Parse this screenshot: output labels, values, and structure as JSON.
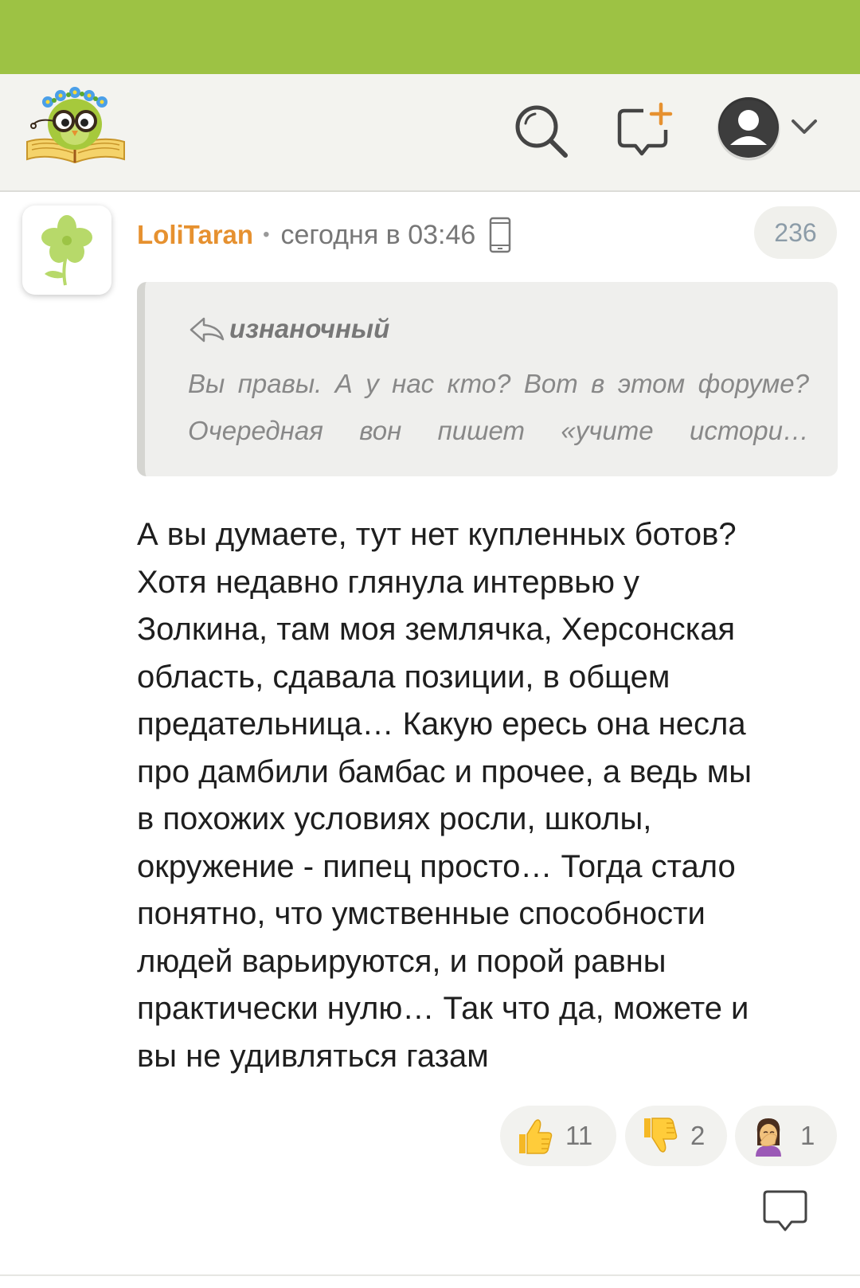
{
  "header": {
    "logo": "owl-reading-book-logo",
    "icons": [
      "search-icon",
      "new-post-icon",
      "user-icon",
      "chevron-down-icon"
    ]
  },
  "comment": {
    "username": "LoliTaran",
    "separator": "•",
    "timestamp": "сегодня в 03:46",
    "device_icon": "mobile-device-icon",
    "number": "236",
    "quote": {
      "author": "изнаночный",
      "text": "Вы правы. А у нас кто? Вот в этом форуме? Очередная вон пишет «учите истори…"
    },
    "body": "А вы думаете, тут нет купленных ботов?\nХотя недавно глянула интервью у\nЗолкина, там моя землячка, Херсонская\nобласть, сдавала позиции, в общем\nпредательница… Какую ересь она несла\nпро дамбили бамбас и прочее, а ведь мы\nв похожих условиях росли, школы,\nокружение - пипец просто… Тогда стало\nпонятно, что умственные способности\nлюдей варьируются, и порой равны\nпрактически нулю… Так что да, можете и\nвы не удивляться газам",
    "reactions": [
      {
        "icon": "thumbs-up-icon",
        "count": "11"
      },
      {
        "icon": "thumbs-down-icon",
        "count": "2"
      },
      {
        "icon": "facepalm-icon",
        "count": "1"
      }
    ]
  },
  "colors": {
    "status_bar": "#9dc244",
    "header_bg": "#f3f3ef",
    "username": "#e69130",
    "text": "#1e1e1e"
  }
}
